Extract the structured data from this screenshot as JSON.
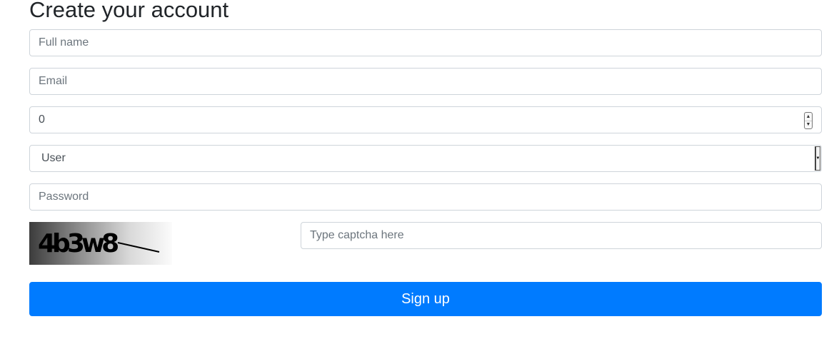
{
  "page": {
    "title": "Create your account"
  },
  "form": {
    "full_name": {
      "placeholder": "Full name",
      "value": ""
    },
    "email": {
      "placeholder": "Email",
      "value": ""
    },
    "number": {
      "value": "0"
    },
    "role_select": {
      "selected": "User"
    },
    "password": {
      "placeholder": "Password",
      "value": ""
    },
    "captcha": {
      "text": "4b3w8"
    },
    "captcha_input": {
      "placeholder": "Type captcha here",
      "value": ""
    },
    "submit_label": "Sign up"
  },
  "colors": {
    "primary": "#007bff",
    "border": "#ced4da",
    "placeholder": "#6c757d",
    "heading": "#212529"
  },
  "icons": {
    "spinner_up": "chevron-up-icon",
    "spinner_down": "chevron-down-icon",
    "select_arrow": "caret-down-icon"
  }
}
